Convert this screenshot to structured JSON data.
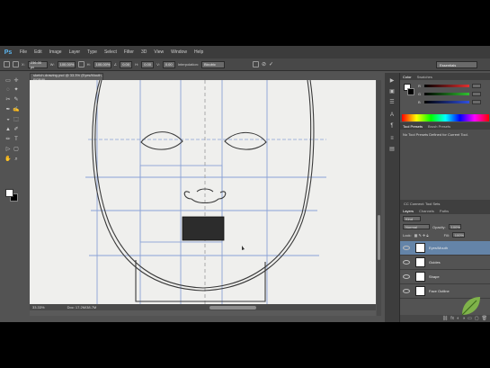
{
  "app": {
    "logo": "Ps",
    "menus": [
      "File",
      "Edit",
      "Image",
      "Layer",
      "Type",
      "Select",
      "Filter",
      "3D",
      "View",
      "Window",
      "Help"
    ]
  },
  "options": {
    "x_label": "X:",
    "x_value": "236.00 px",
    "w_label": "W:",
    "w_value": "100.00%",
    "h_label": "H:",
    "h_value": "100.00%",
    "angle_value": "0.00",
    "hskew_value": "0.00",
    "vskew_value": "0.00",
    "interp_label": "Interpolation:",
    "interp_value": "Bicubic",
    "workspace": "Essentials"
  },
  "document": {
    "tab_title": "sketch-drawing.psd @ 33.3% (Eyes/Mouth, RGB/8)",
    "zoom": "33.33%",
    "doc_info": "Doc: 17.2M/38.7M"
  },
  "tools": [
    "▭",
    "✛",
    "◌",
    "✦",
    "✂",
    "✎",
    "✒",
    "✍",
    "◒",
    "⬚",
    "▲",
    "✐",
    "✏",
    "T",
    "▷",
    "▢",
    "✋",
    "⌕"
  ],
  "dock_icons": [
    "▶",
    "▣",
    "☰",
    "A",
    "¶",
    "≡",
    "▤"
  ],
  "color_panel": {
    "tabs": [
      "Color",
      "Swatches"
    ],
    "channels": [
      {
        "label": "R",
        "color": "#e03030"
      },
      {
        "label": "G",
        "color": "#30c030"
      },
      {
        "label": "B",
        "color": "#3050e0"
      }
    ]
  },
  "tool_presets": {
    "tabs": [
      "Tool Presets",
      "Brush Presets"
    ],
    "empty_text": "No Tool Presets Defined for Current Tool."
  },
  "cc_header": "CC Connect: Tool Sets",
  "layers_panel": {
    "tabs": [
      "Layers",
      "Channels",
      "Paths"
    ],
    "filter_kind": "Kind",
    "blend_mode": "Normal",
    "opacity_label": "Opacity:",
    "opacity": "100%",
    "lock_label": "Lock:",
    "fill_label": "Fill:",
    "fill": "100%",
    "layers": [
      {
        "name": "Eyes/Mouth",
        "selected": true
      },
      {
        "name": "Guides",
        "selected": false
      },
      {
        "name": "Shape",
        "selected": false
      },
      {
        "name": "Face Outline",
        "selected": false
      }
    ]
  },
  "accent_color": "#6484a8",
  "guide_color": "#8aa2d6"
}
